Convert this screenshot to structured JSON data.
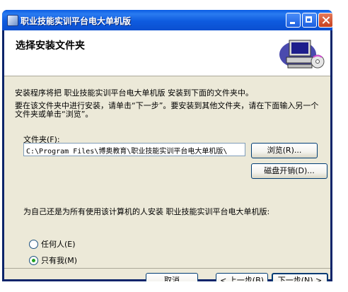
{
  "window": {
    "title": "职业技能实训平台电大单机版"
  },
  "header": {
    "title": "选择安装文件夹"
  },
  "body": {
    "desc1": "安装程序将把 职业技能实训平台电大单机版 安装到下面的文件夹中。",
    "desc2": "要在该文件夹中进行安装，请单击“下一步”。要安装到其他文件夹，请在下面输入另一个文件夹或单击“浏览”。",
    "folder_label": "文件夹(F):",
    "folder_path": "C:\\Program Files\\博奥教育\\职业技能实训平台电大单机版\\",
    "browse_label": "浏览(R)...",
    "disk_cost_label": "磁盘开销(D)...",
    "question": "为自己还是为所有使用该计算机的人安装 职业技能实训平台电大单机版:",
    "option_everyone": "任何人(E)",
    "option_just_me": "只有我(M)",
    "selected_option": "just_me"
  },
  "footer": {
    "cancel_label": "取消",
    "back_label": "< 上一步(B)",
    "next_label": "下一步(N) >"
  }
}
